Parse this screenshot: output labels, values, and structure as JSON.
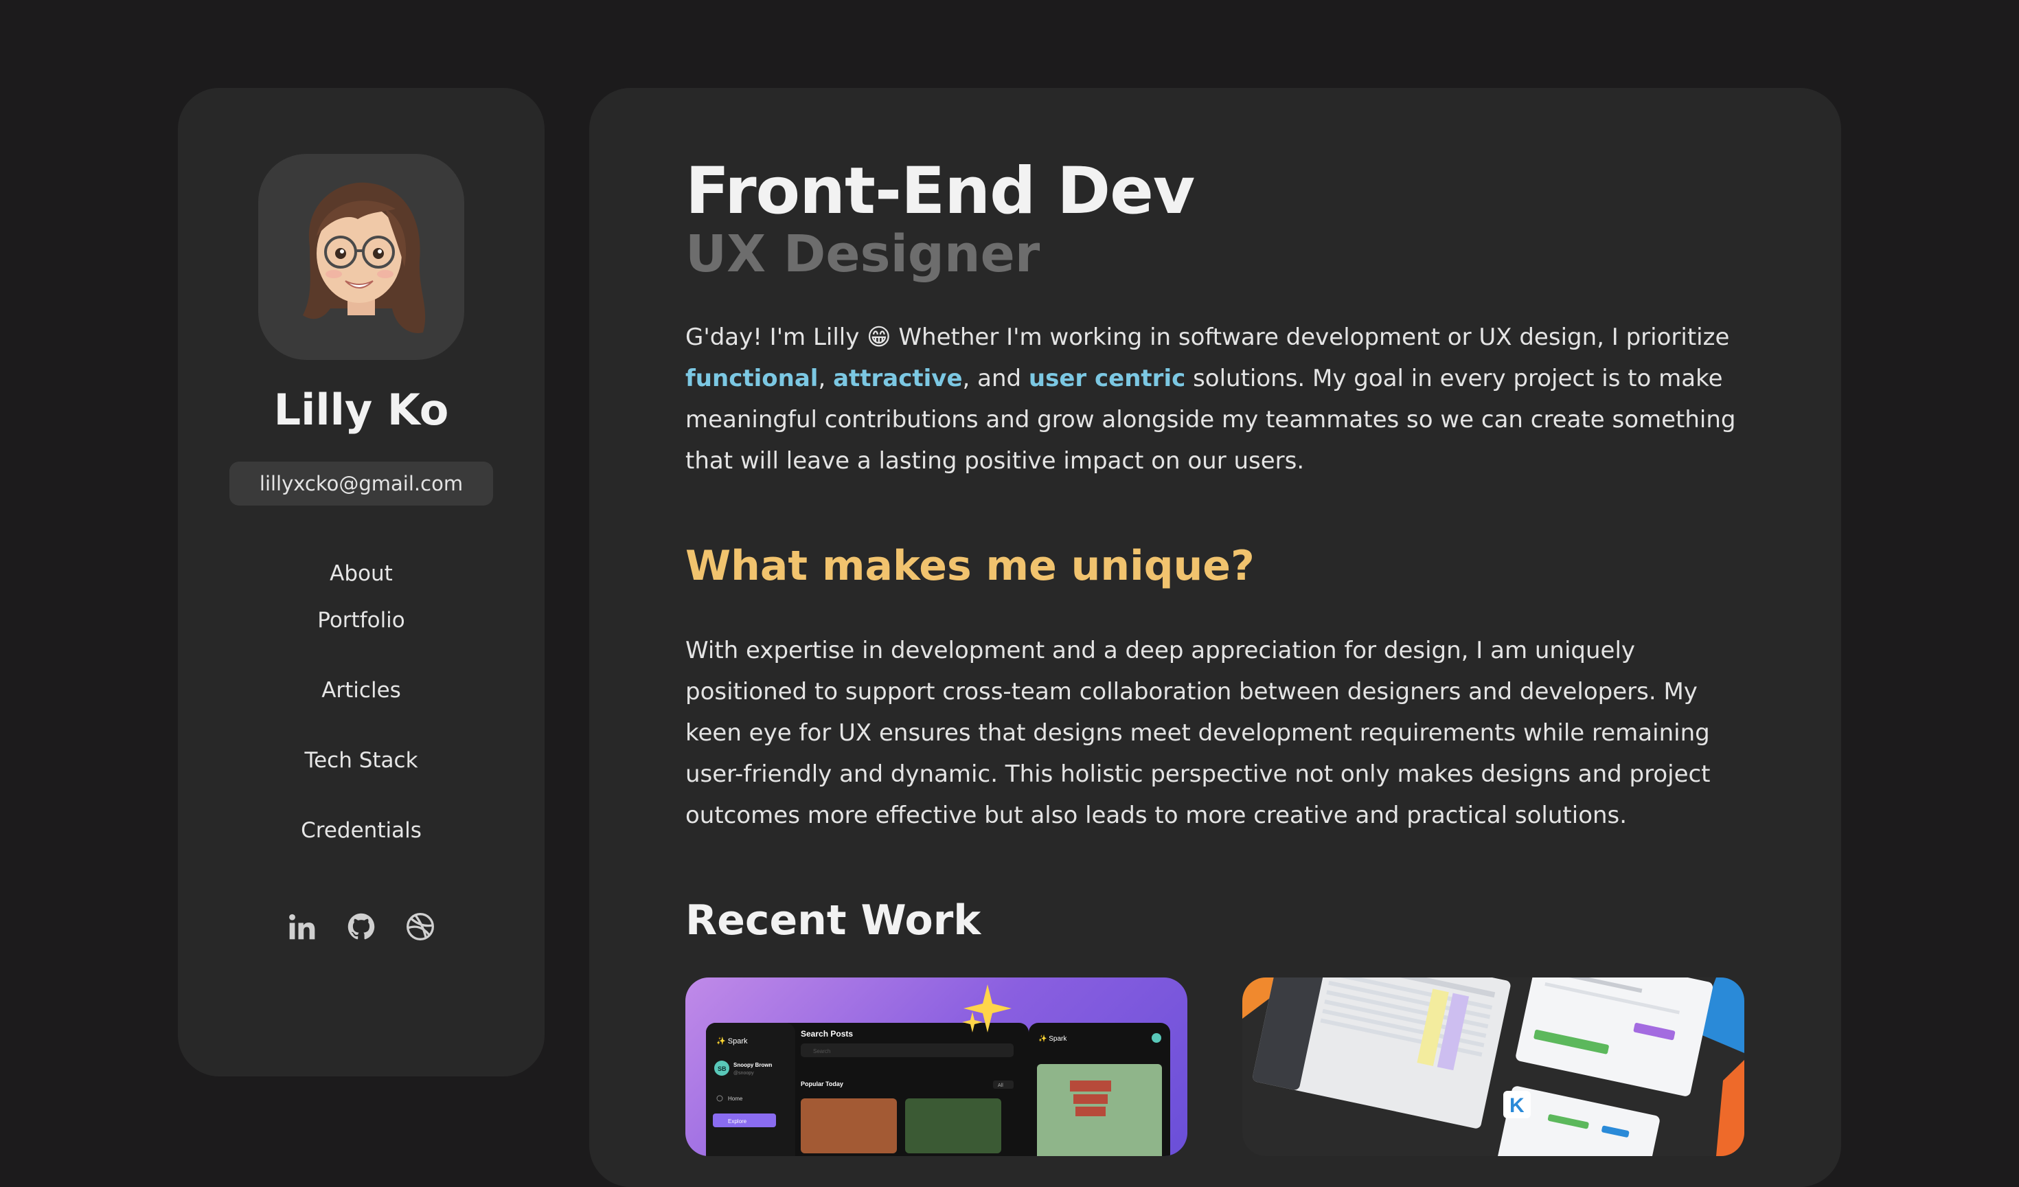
{
  "profile": {
    "name": "Lilly Ko",
    "email": "lillyxcko@gmail.com",
    "avatar_icon": "memoji-avatar"
  },
  "nav": {
    "items": [
      {
        "label": "About"
      },
      {
        "label": "Portfolio"
      },
      {
        "label": "Articles"
      },
      {
        "label": "Tech Stack"
      },
      {
        "label": "Credentials"
      }
    ]
  },
  "socials": [
    {
      "icon": "linkedin-icon"
    },
    {
      "icon": "github-icon"
    },
    {
      "icon": "dribbble-icon"
    }
  ],
  "hero": {
    "title": "Front-End Dev",
    "subtitle": "UX Designer"
  },
  "intro": {
    "part1": "G'day! I'm Lilly 😁 Whether I'm working in software development or UX design, I prioritize ",
    "highlight1": "functional",
    "sep1": ", ",
    "highlight2": "attractive",
    "sep2": ", and ",
    "highlight3": "user centric",
    "part2": " solutions. My goal in every project is to make meaningful contributions and grow alongside my teammates so we can create something that will leave a lasting positive impact on our users."
  },
  "unique": {
    "title": "What makes me unique?",
    "text": "With expertise in development and a deep appreciation for design, I am uniquely positioned to support cross-team collaboration between designers and developers. My keen eye for UX ensures that designs meet development requirements while remaining user-friendly and dynamic. This holistic perspective not only makes designs and project outcomes more effective but also leads to more creative and practical solutions."
  },
  "recent_work": {
    "title": "Recent Work",
    "spark_card": {
      "brand": "✨ Spark",
      "search_title": "Search Posts",
      "search_placeholder": "Search",
      "user_name": "Snoopy Brown",
      "user_handle": "@snoopy",
      "menu_home": "Home",
      "menu_explore": "Explore",
      "popular_title": "Popular Today",
      "filter_label": "All",
      "avatar_initials": "SB"
    },
    "dashboard_card": {
      "logo_letter": "K"
    }
  },
  "colors": {
    "background": "#1c1b1c",
    "panel": "#282828",
    "accent_blue": "#7cc8e3",
    "accent_yellow": "#f1c36e",
    "muted_gray": "#6d6d6d"
  }
}
